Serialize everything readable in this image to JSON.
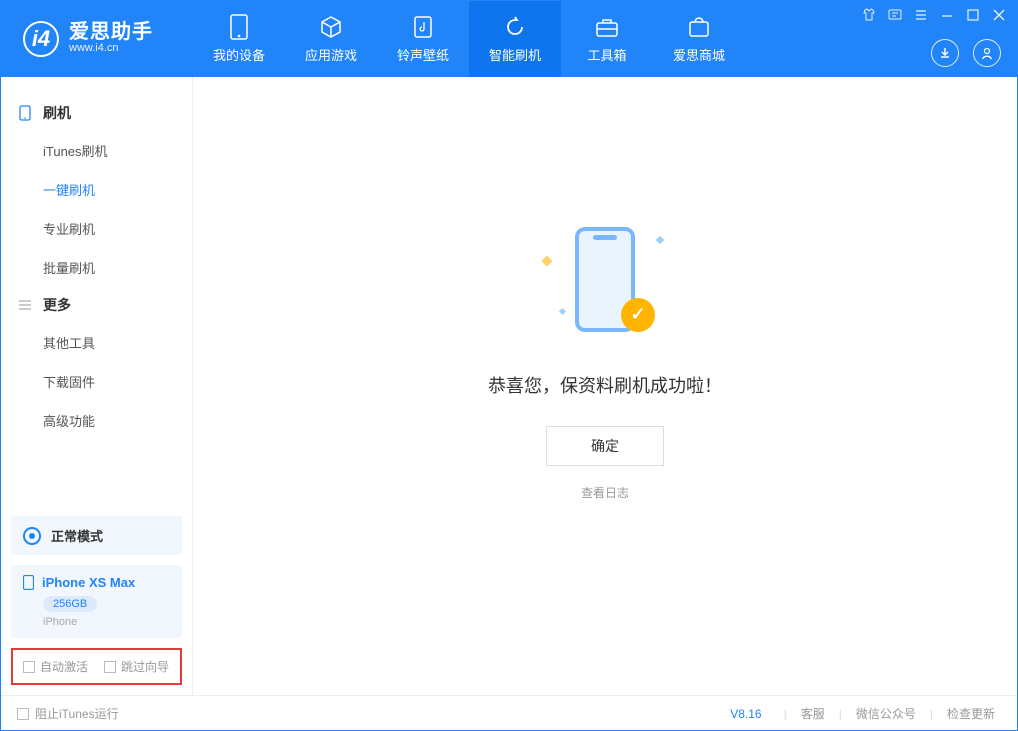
{
  "app": {
    "name_cn": "爱思助手",
    "name_en": "www.i4.cn",
    "logo_letter": "i4"
  },
  "nav": {
    "tabs": [
      {
        "label": "我的设备",
        "icon": "phone-icon"
      },
      {
        "label": "应用游戏",
        "icon": "cube-icon"
      },
      {
        "label": "铃声壁纸",
        "icon": "music-note-icon"
      },
      {
        "label": "智能刷机",
        "icon": "refresh-icon",
        "active": true
      },
      {
        "label": "工具箱",
        "icon": "toolbox-icon"
      },
      {
        "label": "爱思商城",
        "icon": "cart-icon"
      }
    ]
  },
  "sidebar": {
    "group1": {
      "label": "刷机",
      "items": [
        {
          "label": "iTunes刷机"
        },
        {
          "label": "一键刷机",
          "active": true
        },
        {
          "label": "专业刷机"
        },
        {
          "label": "批量刷机"
        }
      ]
    },
    "group2": {
      "label": "更多",
      "items": [
        {
          "label": "其他工具"
        },
        {
          "label": "下载固件"
        },
        {
          "label": "高级功能"
        }
      ]
    },
    "mode_label": "正常模式",
    "device": {
      "name": "iPhone XS Max",
      "capacity": "256GB",
      "type": "iPhone"
    },
    "cb1": "自动激活",
    "cb2": "跳过向导"
  },
  "content": {
    "success_message": "恭喜您，保资料刷机成功啦！",
    "ok_button": "确定",
    "log_link": "查看日志"
  },
  "footer": {
    "stop_itunes": "阻止iTunes运行",
    "version": "V8.16",
    "links": [
      "客服",
      "微信公众号",
      "检查更新"
    ]
  }
}
